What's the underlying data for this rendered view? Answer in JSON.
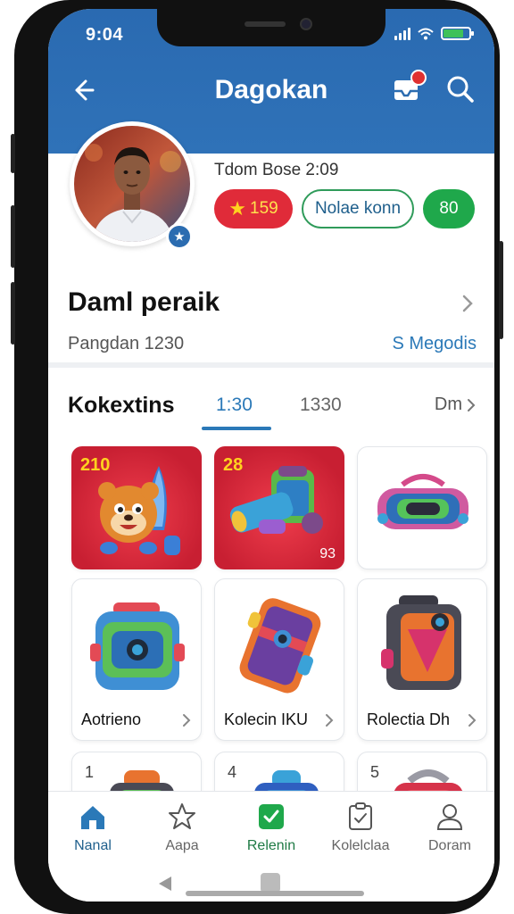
{
  "status_bar": {
    "time": "9:04"
  },
  "header": {
    "title": "Dagokan"
  },
  "profile": {
    "team_base": "Tdom Bose 2:09",
    "chips": {
      "star_value": "159",
      "outline_label": "Nolae konn",
      "green_value": "80"
    },
    "name": "Daml peraik",
    "subtitle": "Pangdan 1230",
    "link": "S Megodis"
  },
  "collection": {
    "title": "Kokextins",
    "tabs": [
      "1:30",
      "1330"
    ],
    "more": "Dm"
  },
  "cards": [
    {
      "number": "210",
      "count": "",
      "label": ""
    },
    {
      "number": "28",
      "count": "93",
      "label": ""
    },
    {
      "number": "",
      "count": "",
      "label": ""
    },
    {
      "number": "",
      "count": "",
      "label": "Aotrieno"
    },
    {
      "number": "",
      "count": "",
      "label": "Kolecin IKU"
    },
    {
      "number": "",
      "count": "",
      "label": "Rolectia Dh"
    },
    {
      "number": "1",
      "count": "",
      "label": ""
    },
    {
      "number": "4",
      "count": "",
      "label": ""
    },
    {
      "number": "5",
      "count": "",
      "label": ""
    }
  ],
  "bottom_nav": [
    {
      "label": "Nanal",
      "icon": "home-icon"
    },
    {
      "label": "Aapa",
      "icon": "star-icon"
    },
    {
      "label": "Relenin",
      "icon": "check-square-icon"
    },
    {
      "label": "Kolelclaa",
      "icon": "clipboard-icon"
    },
    {
      "label": "Doram",
      "icon": "user-icon"
    }
  ],
  "colors": {
    "header_blue": "#2b6cb0",
    "accent_blue": "#2b79b8",
    "red": "#e02b39",
    "green": "#1fa84b"
  }
}
